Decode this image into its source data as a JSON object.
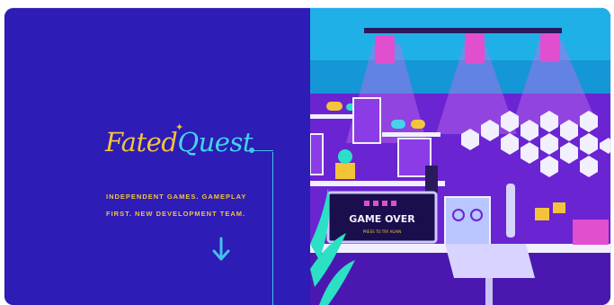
{
  "brand": {
    "word1": "Fated",
    "word2": "Quest"
  },
  "tagline": {
    "line1": "INDEPENDENT GAMES. GAMEPLAY",
    "line2": "FIRST. NEW DEVELOPMENT TEAM."
  },
  "screen": {
    "title": "GAME OVER",
    "subtitle": "PRESS TO TRY AGAIN"
  },
  "icons": {
    "scroll": "arrow-down-icon"
  },
  "colors": {
    "panel_bg": "#2d1cb6",
    "accent_gold": "#f3c43a",
    "accent_cyan": "#42d4ec"
  }
}
